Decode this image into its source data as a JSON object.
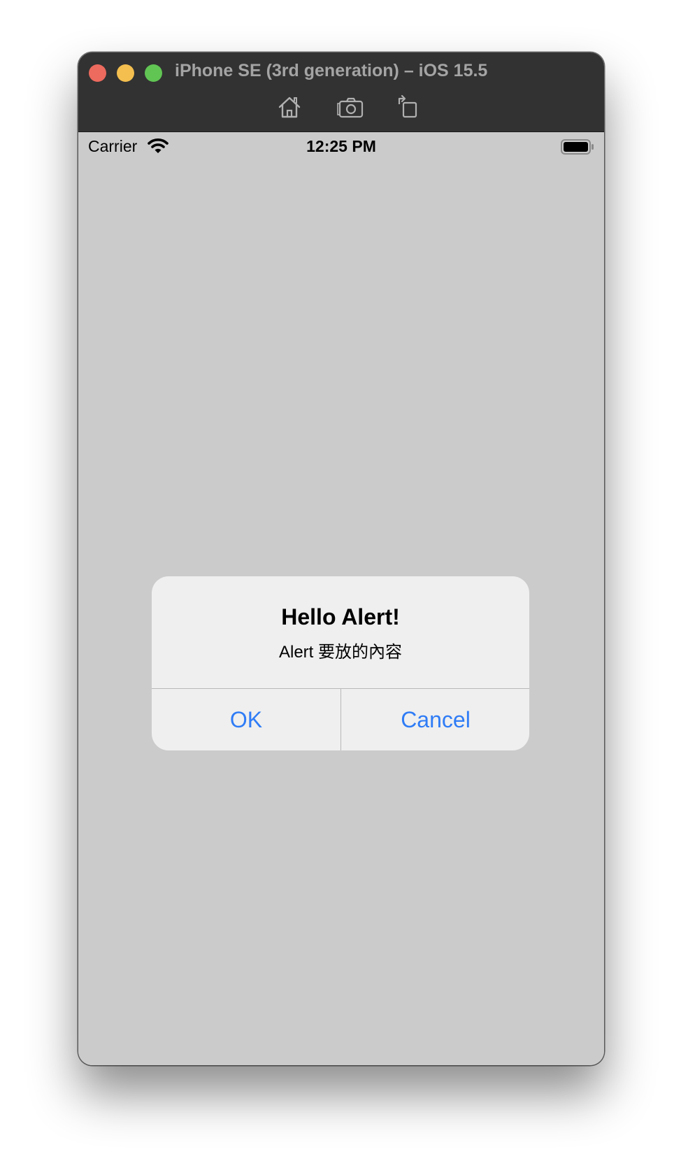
{
  "window": {
    "title": "iPhone SE (3rd generation) – iOS 15.5",
    "toolbar": {
      "home_icon": "home-icon",
      "screenshot_icon": "screenshot-icon",
      "rotate_icon": "rotate-icon"
    }
  },
  "status_bar": {
    "carrier": "Carrier",
    "time": "12:25 PM",
    "wifi_icon": "wifi-icon",
    "battery_icon": "battery-icon"
  },
  "alert": {
    "title": "Hello Alert!",
    "message": "Alert 要放的內容",
    "buttons": {
      "ok": "OK",
      "cancel": "Cancel"
    }
  },
  "colors": {
    "screen_background": "#cbcbcb",
    "titlebar": "#323232",
    "alert_background": "#efefef",
    "button_tint": "#2f7cf6",
    "close": "#ec6a5e",
    "minimize": "#f4bf4f",
    "zoom": "#61c554"
  }
}
